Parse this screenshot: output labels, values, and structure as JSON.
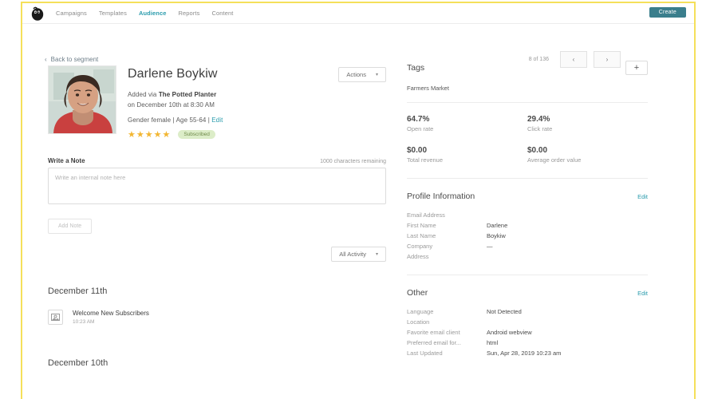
{
  "topnav": {
    "logo_icon": "mailchimp-freddie-logo",
    "items": [
      {
        "label": "Campaigns",
        "active": false
      },
      {
        "label": "Templates",
        "active": false
      },
      {
        "label": "Audience",
        "active": true
      },
      {
        "label": "Reports",
        "active": false
      },
      {
        "label": "Content",
        "active": false
      }
    ],
    "create_label": "Create",
    "accent_teal": "#2b9cad",
    "create_bg": "#3a7e8c"
  },
  "subheader": {
    "back_label": "Back to segment",
    "back_chevron": "‹",
    "pager_count": "8 of 136",
    "prev_icon": "‹",
    "next_icon": "›"
  },
  "contact": {
    "name": "Darlene Boykiw",
    "added_via_prefix": "Added via ",
    "added_via_source": "The Potted Planter",
    "added_on": "on December 10th at 8:30 AM",
    "demographics": "Gender female | Age 55-64 | ",
    "edit_label": "Edit",
    "stars": "★★★★★",
    "star_count": 5,
    "status_badge": "Subscribed",
    "actions_label": "Actions",
    "caret": "▾"
  },
  "note": {
    "title": "Write a Note",
    "chars_remaining": "1000 characters remaining",
    "placeholder": "Write an internal note here",
    "value": "",
    "add_label": "Add Note"
  },
  "activity": {
    "filter_label": "All Activity",
    "caret": "▾",
    "groups": [
      {
        "date": "December 11th",
        "items": [
          {
            "icon": "campaign-email-icon",
            "title": "Welcome New Subscribers",
            "time": "10:23 AM"
          }
        ]
      },
      {
        "date": "December 10th",
        "items": []
      }
    ]
  },
  "tags": {
    "title": "Tags",
    "add_icon": "+",
    "values": [
      "Farmers Market"
    ]
  },
  "stats": [
    {
      "value": "64.7%",
      "label": "Open rate"
    },
    {
      "value": "29.4%",
      "label": "Click rate"
    },
    {
      "value": "$0.00",
      "label": "Total revenue"
    },
    {
      "value": "$0.00",
      "label": "Average order value"
    }
  ],
  "profile": {
    "title": "Profile Information",
    "edit_label": "Edit",
    "fields": [
      {
        "key": "Email Address",
        "value": ""
      },
      {
        "key": "First Name",
        "value": "Darlene"
      },
      {
        "key": "Last Name",
        "value": "Boykiw"
      },
      {
        "key": "Company",
        "value": "—"
      },
      {
        "key": "Address",
        "value": ""
      }
    ]
  },
  "other": {
    "title": "Other",
    "edit_label": "Edit",
    "fields": [
      {
        "key": "Language",
        "value": "Not Detected"
      },
      {
        "key": "Location",
        "value": ""
      },
      {
        "key": "Favorite email client",
        "value": "Android webview"
      },
      {
        "key": "Preferred email for...",
        "value": "html"
      },
      {
        "key": "Last Updated",
        "value": "Sun, Apr 28, 2019 10:23 am"
      }
    ]
  }
}
